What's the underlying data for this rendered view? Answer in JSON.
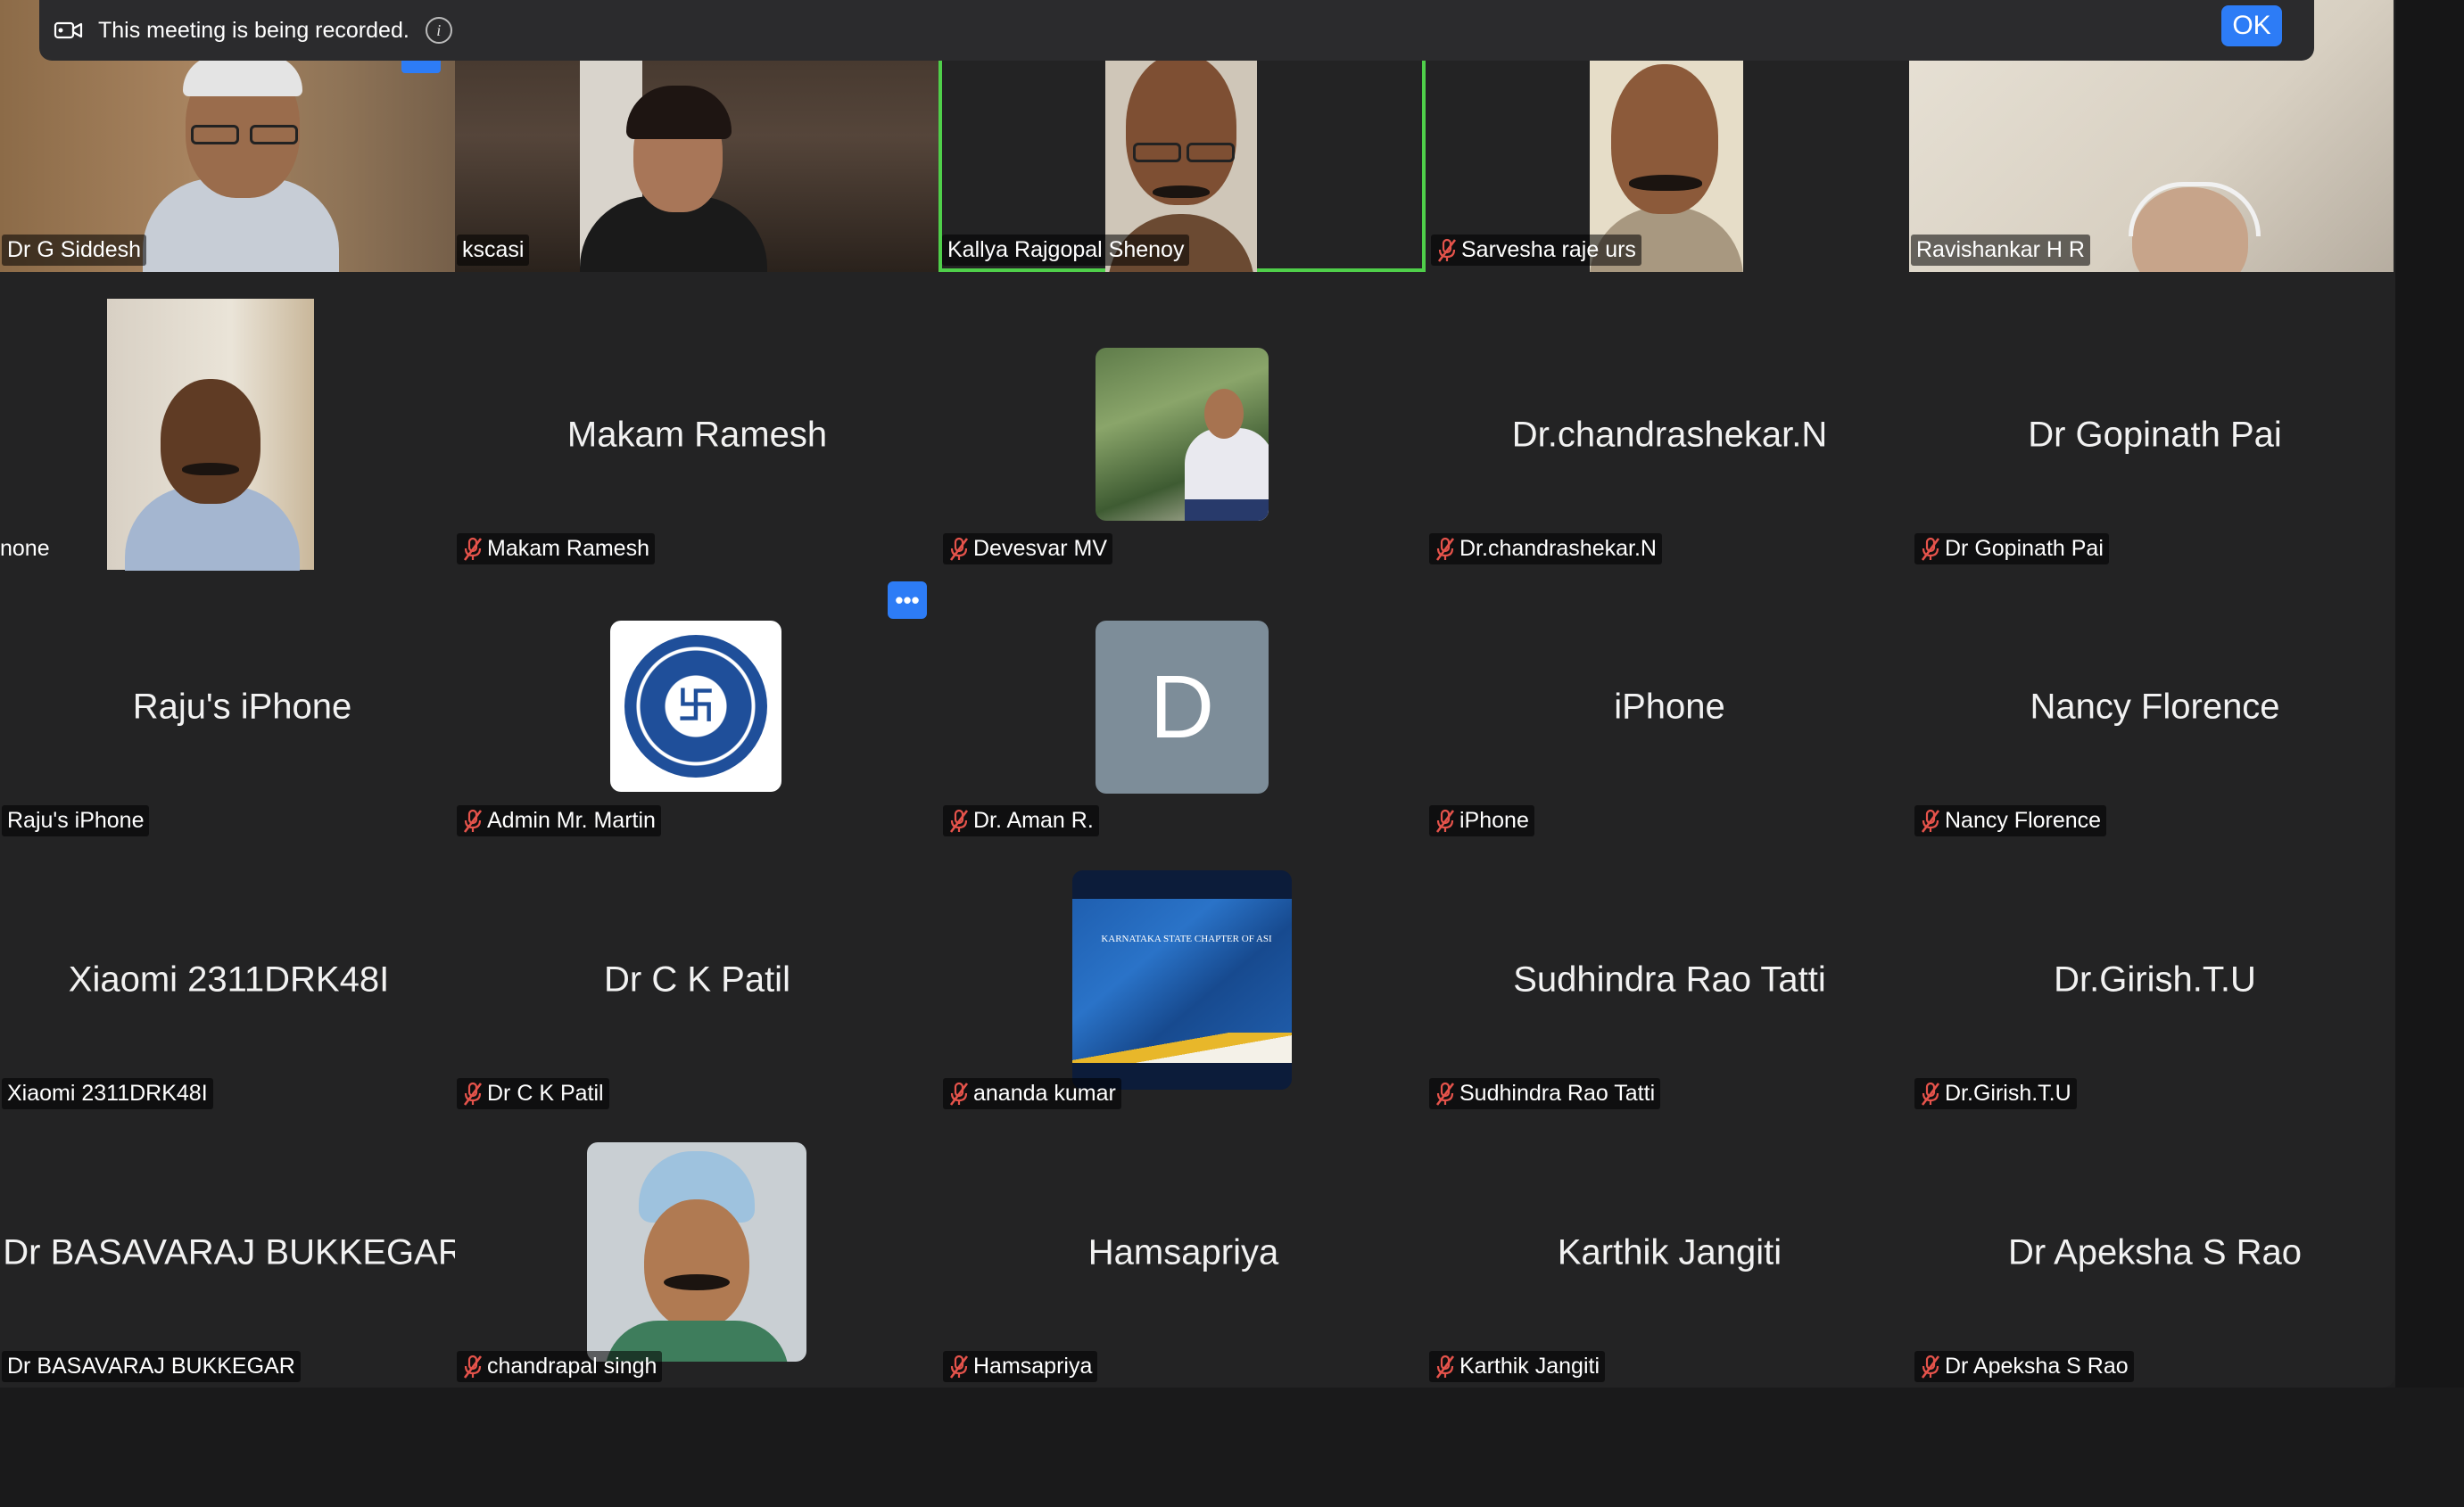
{
  "banner": {
    "text": "This meeting is being recorded.",
    "ok_label": "OK",
    "icon": "camera-record-icon"
  },
  "participants": {
    "r1c1": {
      "name": "Dr G Siddesh",
      "muted": false
    },
    "r1c2": {
      "name": "kscasi",
      "muted": false
    },
    "r1c3": {
      "name": "Kallya Rajgopal Shenoy",
      "muted": false,
      "speaking": true
    },
    "r1c4": {
      "name": "Sarvesha raje urs",
      "muted": true
    },
    "r1c5": {
      "name": "Ravishankar H R",
      "muted": false
    },
    "r2c1": {
      "name": "none",
      "muted": false
    },
    "r2c2": {
      "display": "Makam Ramesh",
      "name": "Makam Ramesh",
      "muted": true
    },
    "r2c3": {
      "name": "Devesvar MV",
      "muted": true
    },
    "r2c4": {
      "display": "Dr.chandrashekar.N",
      "name": "Dr.chandrashekar.N",
      "muted": true
    },
    "r2c5": {
      "display": "Dr Gopinath Pai",
      "name": "Dr Gopinath Pai",
      "muted": true
    },
    "r3c1": {
      "display": "Raju's iPhone",
      "name": "Raju's iPhone",
      "muted": false
    },
    "r3c2": {
      "name": "Admin Mr. Martin",
      "muted": true
    },
    "r3c3": {
      "avatar_letter": "D",
      "name": "Dr. Aman R.",
      "muted": true
    },
    "r3c4": {
      "display": "iPhone",
      "name": "iPhone",
      "muted": true
    },
    "r3c5": {
      "display": "Nancy Florence",
      "name": "Nancy Florence",
      "muted": true
    },
    "r4c1": {
      "display": "Xiaomi 2311DRK48I",
      "name": "Xiaomi 2311DRK48I",
      "muted": false
    },
    "r4c2": {
      "display": "Dr C K Patil",
      "name": "Dr C K Patil",
      "muted": true
    },
    "r4c3": {
      "name": "ananda kumar",
      "muted": true,
      "slide_title": "KARNATAKA STATE CHAPTER OF ASI"
    },
    "r4c4": {
      "display": "Sudhindra Rao Tatti",
      "name": "Sudhindra Rao Tatti",
      "muted": true
    },
    "r4c5": {
      "display": "Dr.Girish.T.U",
      "name": "Dr.Girish.T.U",
      "muted": true
    },
    "r5c1": {
      "display": "Dr BASAVARAJ BUKKEGAR",
      "name": "Dr BASAVARAJ BUKKEGAR",
      "muted": false
    },
    "r5c2": {
      "name": "chandrapal singh",
      "muted": true
    },
    "r5c3": {
      "display": "Hamsapriya",
      "name": "Hamsapriya",
      "muted": true
    },
    "r5c4": {
      "display": "Karthik Jangiti",
      "name": "Karthik Jangiti",
      "muted": true
    },
    "r5c5": {
      "display": "Dr Apeksha S Rao",
      "name": "Dr Apeksha S Rao",
      "muted": true
    }
  },
  "tile_options_label": "•••",
  "colors": {
    "accent": "#2d7cf6",
    "speaking_border": "#4fcf4a",
    "muted_icon": "#e5534b",
    "background": "#232324"
  }
}
